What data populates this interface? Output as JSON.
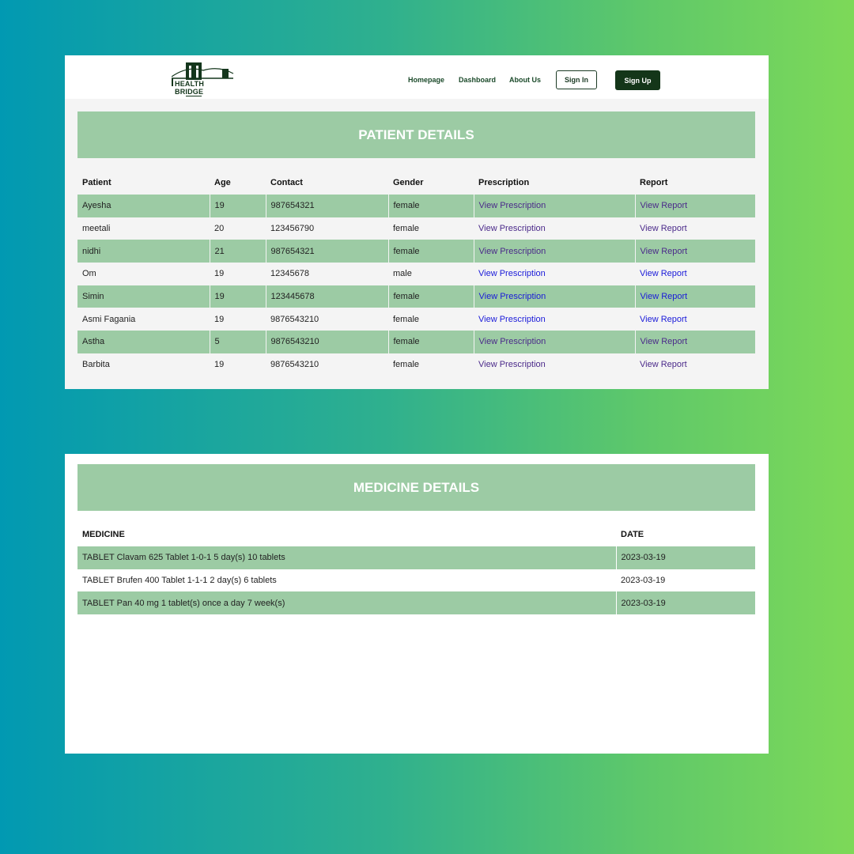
{
  "nav": {
    "logo_text": "HEALTH BRIDGE",
    "links": [
      "Homepage",
      "Dashboard",
      "About Us"
    ],
    "sign_in": "Sign In",
    "sign_up": "Sign Up"
  },
  "patients": {
    "title": "PATIENT DETAILS",
    "columns": [
      "Patient",
      "Age",
      "Contact",
      "Gender",
      "Prescription",
      "Report"
    ],
    "rows": [
      {
        "name": "Ayesha",
        "age": "19",
        "contact": "987654321",
        "gender": "female",
        "prescription": "View Prescription",
        "report": "View Report"
      },
      {
        "name": "meetali",
        "age": "20",
        "contact": "123456790",
        "gender": "female",
        "prescription": "View Prescription",
        "report": "View Report"
      },
      {
        "name": "nidhi",
        "age": "21",
        "contact": "987654321",
        "gender": "female",
        "prescription": "View Prescription",
        "report": "View Report"
      },
      {
        "name": "Om",
        "age": "19",
        "contact": "12345678",
        "gender": "male",
        "prescription": "View Prescription",
        "report": "View Report"
      },
      {
        "name": "Simin",
        "age": "19",
        "contact": "123445678",
        "gender": "female",
        "prescription": "View Prescription",
        "report": "View Report"
      },
      {
        "name": "Asmi Fagania",
        "age": "19",
        "contact": "9876543210",
        "gender": "female",
        "prescription": "View Prescription",
        "report": "View Report"
      },
      {
        "name": "Astha",
        "age": "5",
        "contact": "9876543210",
        "gender": "female",
        "prescription": "View Prescription",
        "report": "View Report"
      },
      {
        "name": "Barbita",
        "age": "19",
        "contact": "9876543210",
        "gender": "female",
        "prescription": "View Prescription",
        "report": "View Report"
      }
    ]
  },
  "medicines": {
    "title": "MEDICINE DETAILS",
    "columns": [
      "MEDICINE",
      "DATE"
    ],
    "rows": [
      {
        "medicine": "TABLET Clavam 625 Tablet 1-0-1 5 day(s) 10 tablets",
        "date": "2023-03-19"
      },
      {
        "medicine": "TABLET Brufen 400 Tablet 1-1-1 2 day(s) 6 tablets",
        "date": "2023-03-19"
      },
      {
        "medicine": "TABLET Pan 40 mg 1 tablet(s) once a day 7 week(s)",
        "date": "2023-03-19"
      }
    ]
  }
}
